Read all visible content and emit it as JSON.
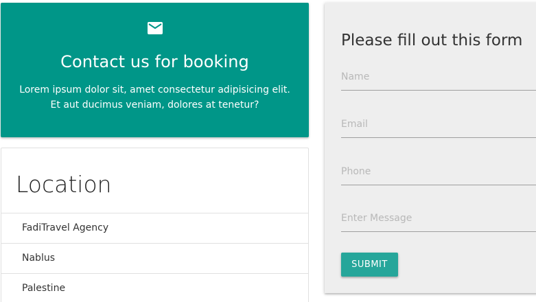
{
  "theme": {
    "primary": "#009688",
    "button": "#26a69a",
    "form_background": "#eeeeee"
  },
  "contact": {
    "icon": "mail-icon",
    "title": "Contact us for booking",
    "text": "Lorem ipsum dolor sit, amet consectetur adipisicing elit. Et aut ducimus veniam, dolores at tenetur?"
  },
  "location": {
    "title": "Location",
    "items": [
      "FadiTravel Agency",
      "Nablus",
      "Palestine"
    ]
  },
  "form": {
    "title": "Please fill out this form",
    "name_placeholder": "Name",
    "email_placeholder": "Email",
    "phone_placeholder": "Phone",
    "message_placeholder": "Enter Message",
    "submit_label": "SUBMIT"
  }
}
